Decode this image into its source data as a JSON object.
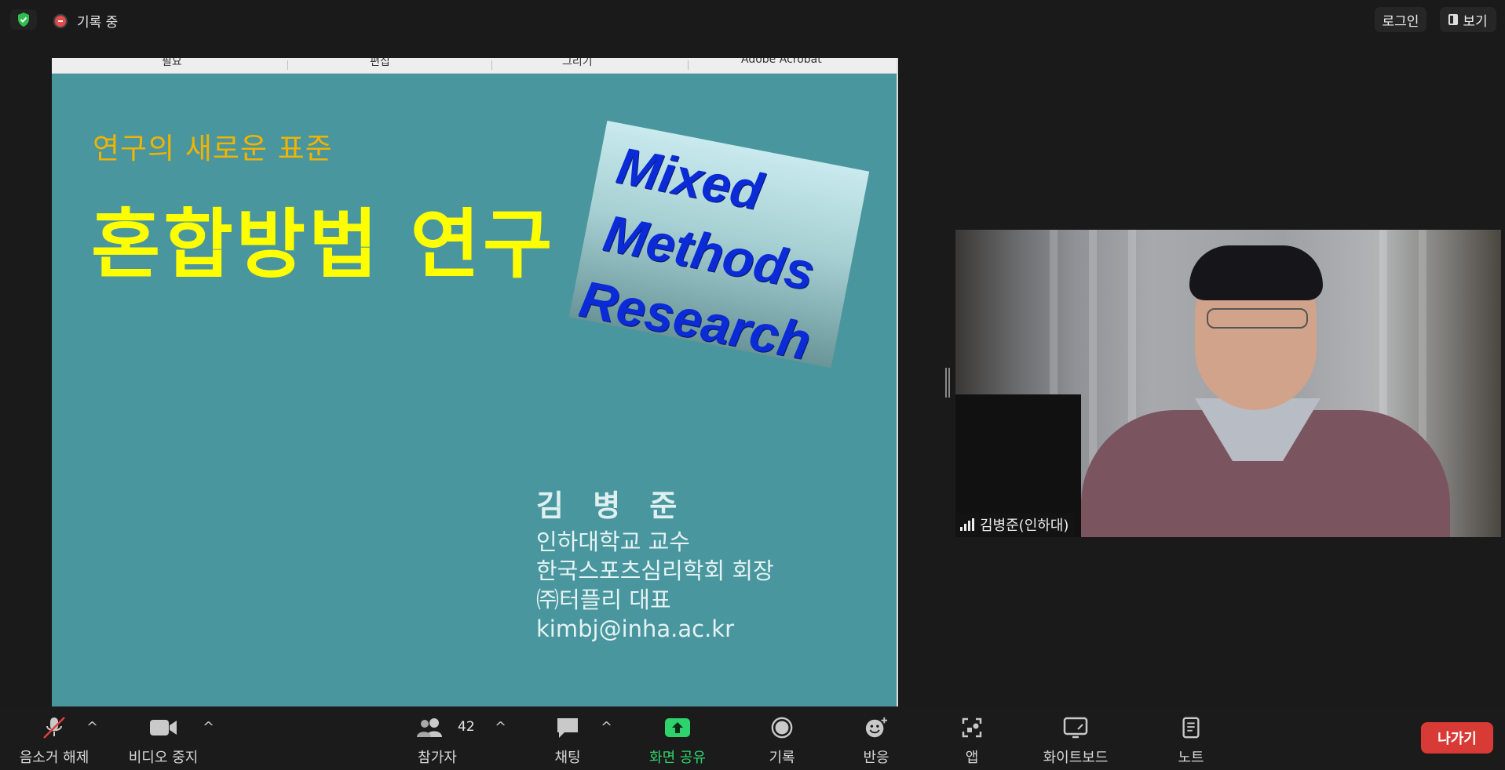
{
  "topbar": {
    "recording_label": "기록 중",
    "login_label": "로그인",
    "view_label": "보기"
  },
  "slide": {
    "ribbon_tabs": [
      "필요",
      "편집",
      "그리기",
      "Adobe Acrobat"
    ],
    "subtitle": "연구의 새로운 표준",
    "title": "혼합방법 연구",
    "mmr_lines": [
      "Mixed",
      "Methods",
      "Research"
    ],
    "presenter_name": "김 병 준",
    "presenter_lines": [
      "인하대학교 교수",
      "한국스포츠심리학회 회장",
      "㈜터플리 대표",
      "kimbj@inha.ac.kr"
    ]
  },
  "video": {
    "participant_name": "김병준(인하대)"
  },
  "toolbar": {
    "mute_label": "음소거 해제",
    "video_label": "비디오 중지",
    "participants_label": "참가자",
    "participants_count": "42",
    "chat_label": "채팅",
    "share_label": "화면 공유",
    "record_label": "기록",
    "reactions_label": "반응",
    "apps_label": "앱",
    "whiteboard_label": "화이트보드",
    "notes_label": "노트",
    "leave_label": "나가기"
  },
  "colors": {
    "slide_bg": "#4a969e",
    "title_yellow": "#ffff00",
    "subtitle_orange": "#f0b400",
    "mmr_blue": "#0a2bd6",
    "share_green": "#2fd36b",
    "leave_red": "#d83b35"
  }
}
